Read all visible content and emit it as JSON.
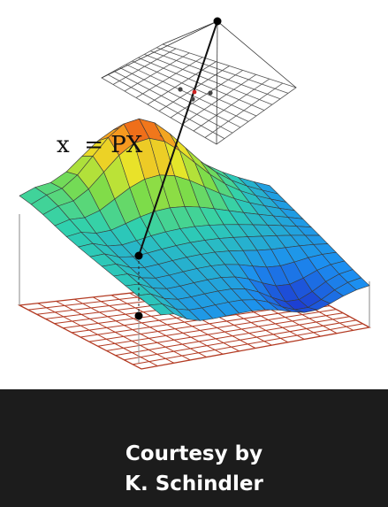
{
  "figure": {
    "equation": "x  = PX"
  },
  "caption": {
    "line1": "Courtesy by",
    "line2": "K. Schindler"
  },
  "colors": {
    "background": "#000000",
    "caption_bg": "#1c1c1c",
    "panel_bg": "#ffffff",
    "ground_grid": "#b33a22",
    "image_plane_grid": "#555555",
    "projected_point": "#cc2222"
  }
}
